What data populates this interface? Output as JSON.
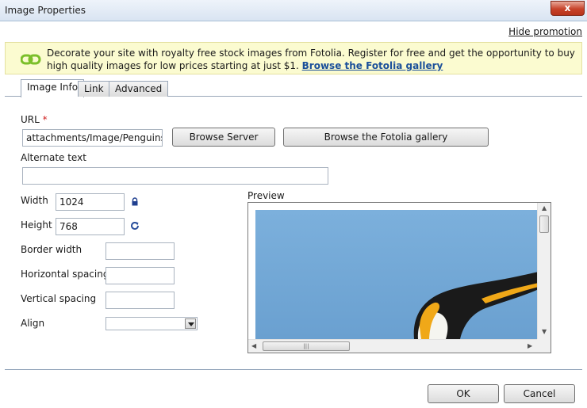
{
  "window": {
    "title": "Image Properties",
    "close_glyph": "x"
  },
  "promo": {
    "hide_label": "Hide promotion",
    "text": "Decorate your site with royalty free stock images from Fotolia. Register for free and get the opportunity to buy high quality images for low prices starting at just $1.",
    "link_label": "Browse the Fotolia gallery"
  },
  "tabs": [
    {
      "label": "Image Info",
      "active": true
    },
    {
      "label": "Link",
      "active": false
    },
    {
      "label": "Advanced",
      "active": false
    }
  ],
  "form": {
    "url_label": "URL",
    "url_required_mark": "*",
    "url_value": "attachments/Image/Penguins.jpg",
    "browse_server_label": "Browse Server",
    "browse_fotolia_label": "Browse the Fotolia gallery",
    "alt_label": "Alternate text",
    "alt_value": "",
    "width_label": "Width",
    "width_value": "1024",
    "height_label": "Height",
    "height_value": "768",
    "border_label": "Border width",
    "border_value": "",
    "hspace_label": "Horizontal spacing",
    "hspace_value": "",
    "vspace_label": "Vertical spacing",
    "vspace_value": "",
    "align_label": "Align",
    "align_value": "",
    "preview_label": "Preview"
  },
  "buttons": {
    "ok": "OK",
    "cancel": "Cancel"
  },
  "icons": {
    "lock": "lock-icon",
    "reset": "reset-size-icon",
    "promo_logo": "fotolia-logo-icon"
  },
  "colors": {
    "sky": "#74a7d6",
    "link": "#1a4f9a",
    "promo_bg": "#fbfbd0"
  }
}
